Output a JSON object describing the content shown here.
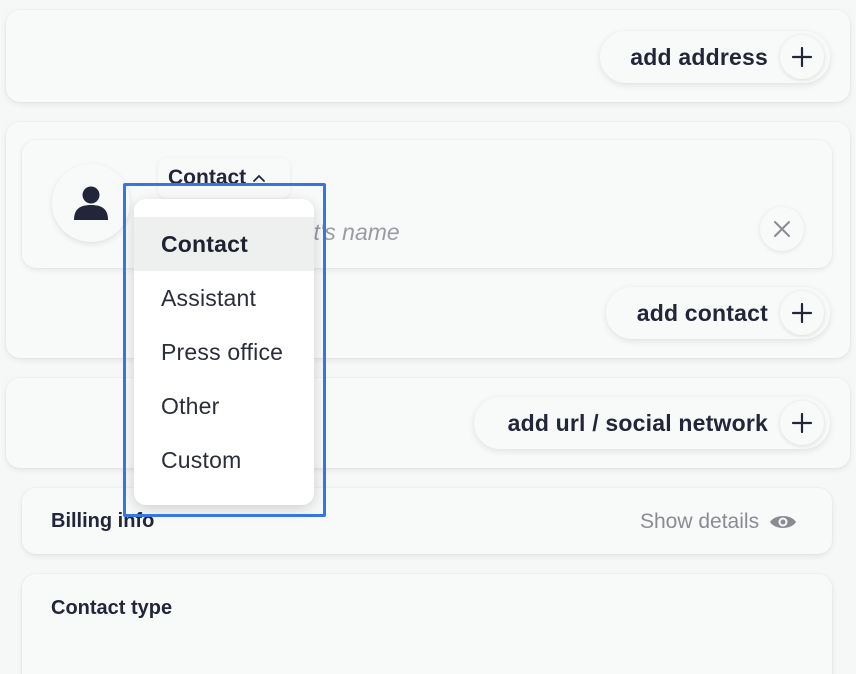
{
  "address_section": {
    "add_label": "add address"
  },
  "contact_section": {
    "type_chip": "Contact",
    "name_placeholder": "Enter the contact's name",
    "add_label": "add contact",
    "dropdown_options": [
      {
        "label": "Contact",
        "selected": true
      },
      {
        "label": "Assistant",
        "selected": false
      },
      {
        "label": "Press office",
        "selected": false
      },
      {
        "label": "Other",
        "selected": false
      },
      {
        "label": "Custom",
        "selected": false
      }
    ]
  },
  "url_section": {
    "add_label": "add url / social network"
  },
  "billing": {
    "title": "Billing info",
    "toggle_label": "Show details"
  },
  "contact_type": {
    "title": "Contact type"
  },
  "icons": {
    "plus": "plus-icon",
    "person": "person-icon",
    "close": "close-icon",
    "chevron": "chevron-up-icon",
    "eye": "eye-icon"
  },
  "colors": {
    "highlight": "#3776e0",
    "text": "#23263a",
    "muted": "#8a8c94"
  }
}
